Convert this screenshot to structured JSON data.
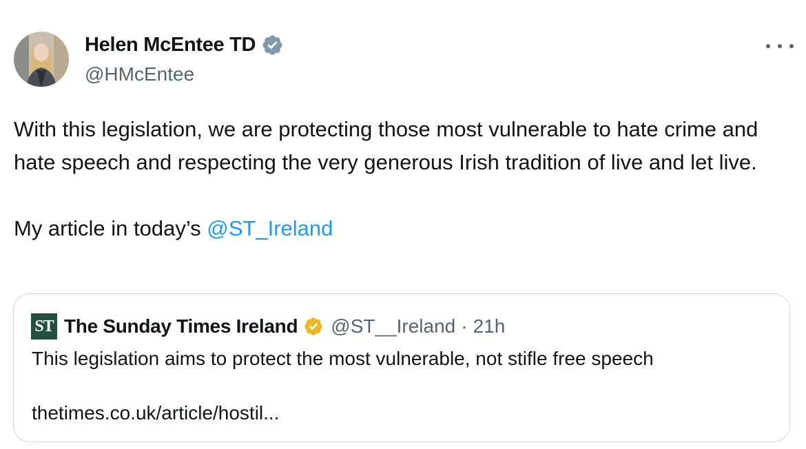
{
  "author": {
    "name": "Helen McEntee TD",
    "handle": "@HMcEntee",
    "verified_badge_color": "#829aab"
  },
  "more_icon": "ellipsis-icon",
  "tweet": {
    "text_main": "With this legislation, we are protecting those most vulnerable to hate crime and hate speech and respecting the very generous Irish tradition of live and let live.\n\nMy article in today’s ",
    "mention": "@ST_Ireland",
    "mention_color": "#1d9bf0"
  },
  "quoted_tweet": {
    "logo_text": "ST",
    "logo_color": "#24503f",
    "name": "The Sunday Times Ireland",
    "verified_badge_color": "#e8b829",
    "handle": "@ST__Ireland",
    "separator": "·",
    "time": "21h",
    "text": "This legislation aims to protect the most vulnerable, not stifle free speech",
    "link": "thetimes.co.uk/article/hostil..."
  }
}
